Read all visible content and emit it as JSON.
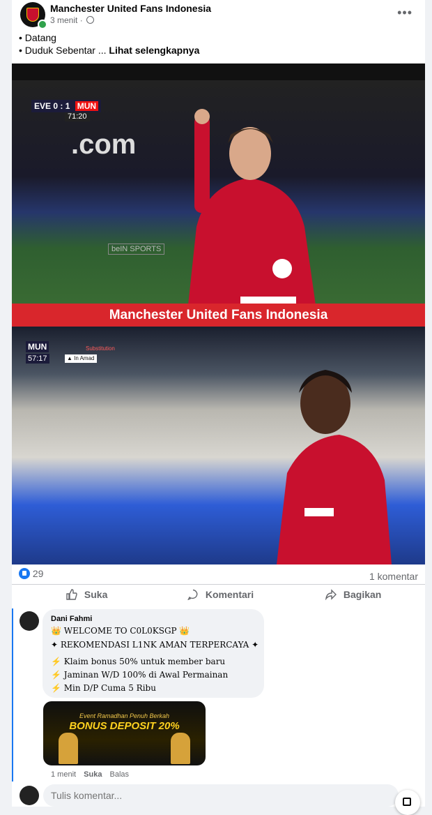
{
  "post": {
    "page_name": "Manchester United Fans Indonesia",
    "time": "3 menit",
    "separator": "·",
    "more_label": "•••",
    "text_line1": "• Datang",
    "text_line2_prefix": "• Duduk Sebentar ... ",
    "see_more": "Lihat selengkapnya"
  },
  "video": {
    "score_home": "EVE",
    "score_value": "0 : 1",
    "score_away": "MUN",
    "clock": "71:20",
    "ad_text": ".com",
    "broadcaster": "beIN SPORTS",
    "banner": "Manchester United  Fans Indonesia",
    "bottom_team": "MUN",
    "bottom_clock": "57:17",
    "substitution_label": "Substitution",
    "substitution_in": "▲ In Amad"
  },
  "engagement": {
    "likes": "29",
    "comments": "1 komentar",
    "like_label": "Suka",
    "comment_label": "Komentari",
    "share_label": "Bagikan"
  },
  "comment": {
    "author": "Dani Fahmi",
    "line1": "👑 WELCOME TO C0L0KSGP 👑",
    "line2": "✦ REKOMENDASI L1NK AMAN TERPERCAYA ✦",
    "line3": "⚡ Klaim bonus 50% untuk member baru",
    "line4": "⚡ Jaminan W/D 100% di Awal Permainan",
    "line5": "⚡ Min D/P Cuma 5 Ribu",
    "promo_top": "Event Ramadhan Penuh Berkah",
    "promo_main": "BONUS DEPOSIT 20%",
    "time": "1 menit",
    "like_label": "Suka",
    "reply_label": "Balas"
  },
  "composer": {
    "placeholder": "Tulis komentar..."
  },
  "colors": {
    "accent": "#1877f2",
    "banner": "#d9262c",
    "online": "#31a24c"
  }
}
